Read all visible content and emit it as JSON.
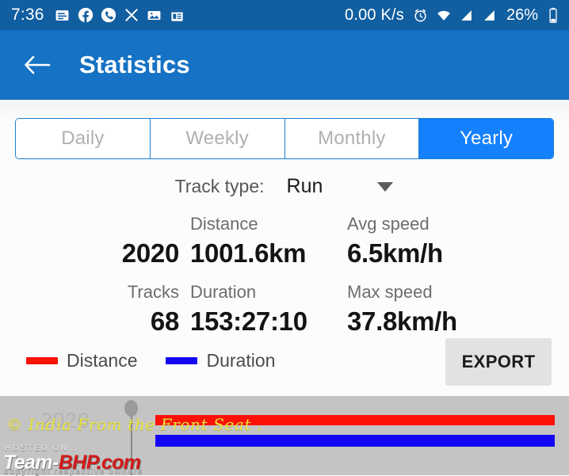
{
  "statusbar": {
    "time": "7:36",
    "network_speed": "0.00 K/s",
    "battery_percent": "26%",
    "left_icons": [
      "news-icon",
      "facebook-icon",
      "phone-call-icon",
      "x-close-icon",
      "gallery-image-icon",
      "calendar-note-icon"
    ],
    "right_icons": [
      "alarm-clock-icon",
      "wifi-icon",
      "signal-bars-icon",
      "signal-bars-icon",
      "battery-icon"
    ]
  },
  "appbar": {
    "back_icon": "back-arrow-icon",
    "title": "Statistics"
  },
  "period_tabs": {
    "items": [
      {
        "label": "Daily",
        "selected": false
      },
      {
        "label": "Weekly",
        "selected": false
      },
      {
        "label": "Monthly",
        "selected": false
      },
      {
        "label": "Yearly",
        "selected": true
      }
    ],
    "selected_color": "#1580fb",
    "border_color": "#1a7fd4",
    "inactive_text_color": "#b0b0b0"
  },
  "track_type": {
    "label": "Track type:",
    "value": "Run",
    "caret_icon": "chevron-down-icon"
  },
  "stats": {
    "row1": {
      "period_label": "",
      "period_value": "2020",
      "col2_label": "Distance",
      "col2_value": "1001.6km",
      "col3_label": "Avg speed",
      "col3_value": "6.5km/h"
    },
    "row2": {
      "period_label": "Tracks",
      "period_value": "68",
      "col2_label": "Duration",
      "col2_value": "153:27:10",
      "col3_label": "Max speed",
      "col3_value": "37.8km/h"
    }
  },
  "legend": {
    "items": [
      {
        "label": "Distance",
        "color": "#fb1105"
      },
      {
        "label": "Duration",
        "color": "#1406f5"
      }
    ]
  },
  "export_button": {
    "label": "EXPORT"
  },
  "watermarks": {
    "script_text": "© India From the Front Seat .",
    "hosted_on": "HOSTED ON :",
    "logo_team": "Team-",
    "logo_bhp": "BHP.com",
    "copyright": "copyright respective owners"
  },
  "chart_data": {
    "type": "bar",
    "orientation": "horizontal",
    "title": "",
    "categories": [
      "2020"
    ],
    "series": [
      {
        "name": "Distance",
        "color": "#fb1105",
        "values": [
          1001.6
        ],
        "unit": "km"
      },
      {
        "name": "Duration",
        "color": "#1406f5",
        "values": [
          153.4528
        ],
        "unit": "h"
      }
    ],
    "xlabel": "",
    "ylabel": "",
    "grid": false,
    "legend_position": "above-left",
    "bar_full_width_fraction": 1.0
  }
}
